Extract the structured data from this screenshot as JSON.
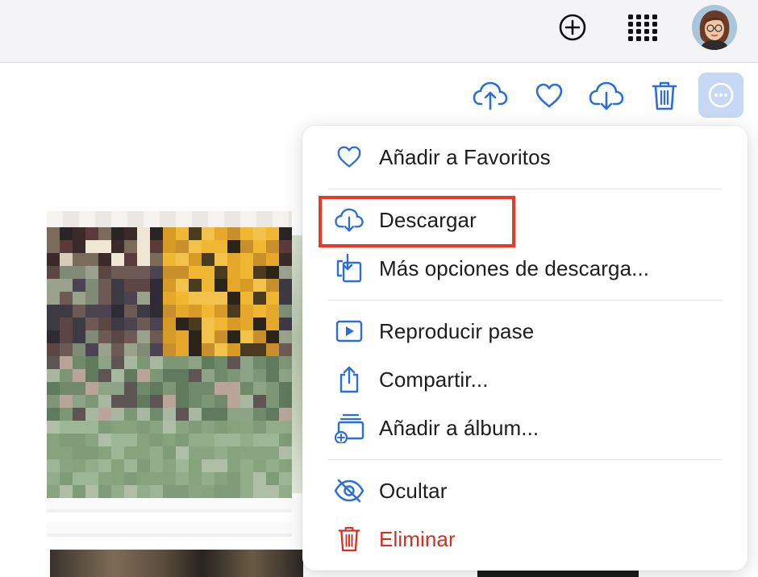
{
  "header": {
    "add_icon": "plus-circle-icon",
    "apps_icon": "app-grid-icon",
    "avatar_icon": "memoji-avatar"
  },
  "toolbar": {
    "icons": [
      "upload-cloud-icon",
      "heart-icon",
      "download-cloud-icon",
      "trash-icon",
      "more-ellipsis-icon"
    ]
  },
  "colors": {
    "accent": "#2a6ed6",
    "danger": "#d92d20",
    "highlight_border": "#e8382a",
    "more_button_bg": "#c6d8f3"
  },
  "menu": {
    "items": [
      {
        "label": "Añadir a Favoritos",
        "icon": "heart-outline-icon"
      },
      {
        "label": "Descargar",
        "icon": "download-cloud-icon",
        "highlighted": true
      },
      {
        "label": "Más opciones de descarga...",
        "icon": "download-options-icon"
      },
      {
        "label": "Reproducir pase",
        "icon": "play-slideshow-icon"
      },
      {
        "label": "Compartir...",
        "icon": "share-icon"
      },
      {
        "label": "Añadir a álbum...",
        "icon": "add-to-album-icon"
      },
      {
        "label": "Ocultar",
        "icon": "eye-slash-icon"
      },
      {
        "label": "Eliminar",
        "icon": "trash-icon",
        "danger": true
      }
    ]
  }
}
